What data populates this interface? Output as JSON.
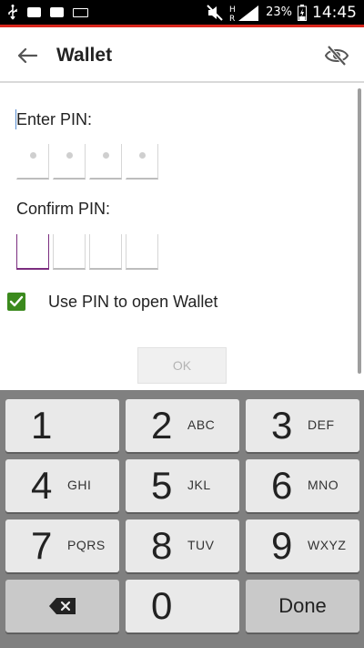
{
  "status_bar": {
    "battery_percent": "23%",
    "time": "14:45",
    "network_label": "H",
    "roaming_label": "R",
    "icons": [
      "usb-icon",
      "notification-icon",
      "notification-icon",
      "keyboard-icon",
      "mute-icon",
      "signal-icon",
      "battery-icon"
    ]
  },
  "app_bar": {
    "title": "Wallet",
    "back_icon": "arrow-left-icon",
    "visibility_icon": "eye-off-icon"
  },
  "form": {
    "enter_pin_label": "Enter PIN:",
    "confirm_pin_label": "Confirm PIN:",
    "enter_pin_digits_filled": 4,
    "confirm_pin_digits_filled": 0,
    "use_pin_checkbox": {
      "label": "Use PIN to open Wallet",
      "checked": true
    },
    "ok_button_label": "OK"
  },
  "keypad": {
    "keys": [
      {
        "digit": "1",
        "letters": ""
      },
      {
        "digit": "2",
        "letters": "ABC"
      },
      {
        "digit": "3",
        "letters": "DEF"
      },
      {
        "digit": "4",
        "letters": "GHI"
      },
      {
        "digit": "5",
        "letters": "JKL"
      },
      {
        "digit": "6",
        "letters": "MNO"
      },
      {
        "digit": "7",
        "letters": "PQRS"
      },
      {
        "digit": "8",
        "letters": "TUV"
      },
      {
        "digit": "9",
        "letters": "WXYZ"
      },
      {
        "digit": "0",
        "letters": ""
      }
    ],
    "done_label": "Done",
    "backspace_icon": "backspace-icon"
  },
  "colors": {
    "accent_red": "#d9261c",
    "checkbox_green": "#3b8a1d",
    "active_pin_purple": "#7b2d7f"
  }
}
